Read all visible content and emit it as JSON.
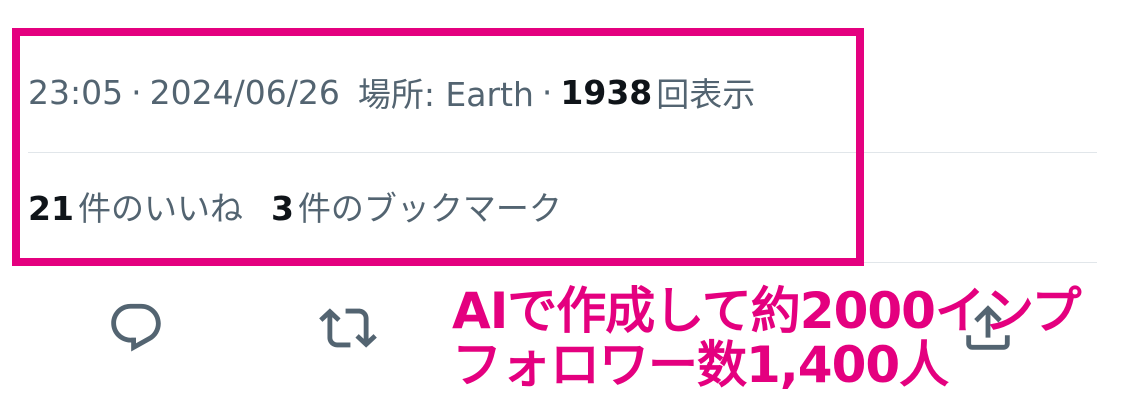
{
  "tweet_meta": {
    "time": "23:05",
    "separator": "·",
    "date": "2024/06/26",
    "location_label": "場所: Earth",
    "views_count": "1938",
    "views_label": "回表示"
  },
  "tweet_stats": {
    "likes_count": "21",
    "likes_label": "件のいいね",
    "bookmarks_count": "3",
    "bookmarks_label": "件のブックマーク"
  },
  "actions": [
    {
      "icon": "reply-icon"
    },
    {
      "icon": "retweet-icon"
    },
    {
      "icon": "like-icon"
    },
    {
      "icon": "share-icon"
    }
  ],
  "caption": {
    "line1": "AIで作成して約2000インプ",
    "line2": "フォロワー数1,400人",
    "color": "#e4007f"
  },
  "colors": {
    "secondary_text": "#536471",
    "primary_text": "#0f1419",
    "icon": "#536471",
    "highlight": "#e4007f",
    "divider": "#e1e6ea"
  }
}
